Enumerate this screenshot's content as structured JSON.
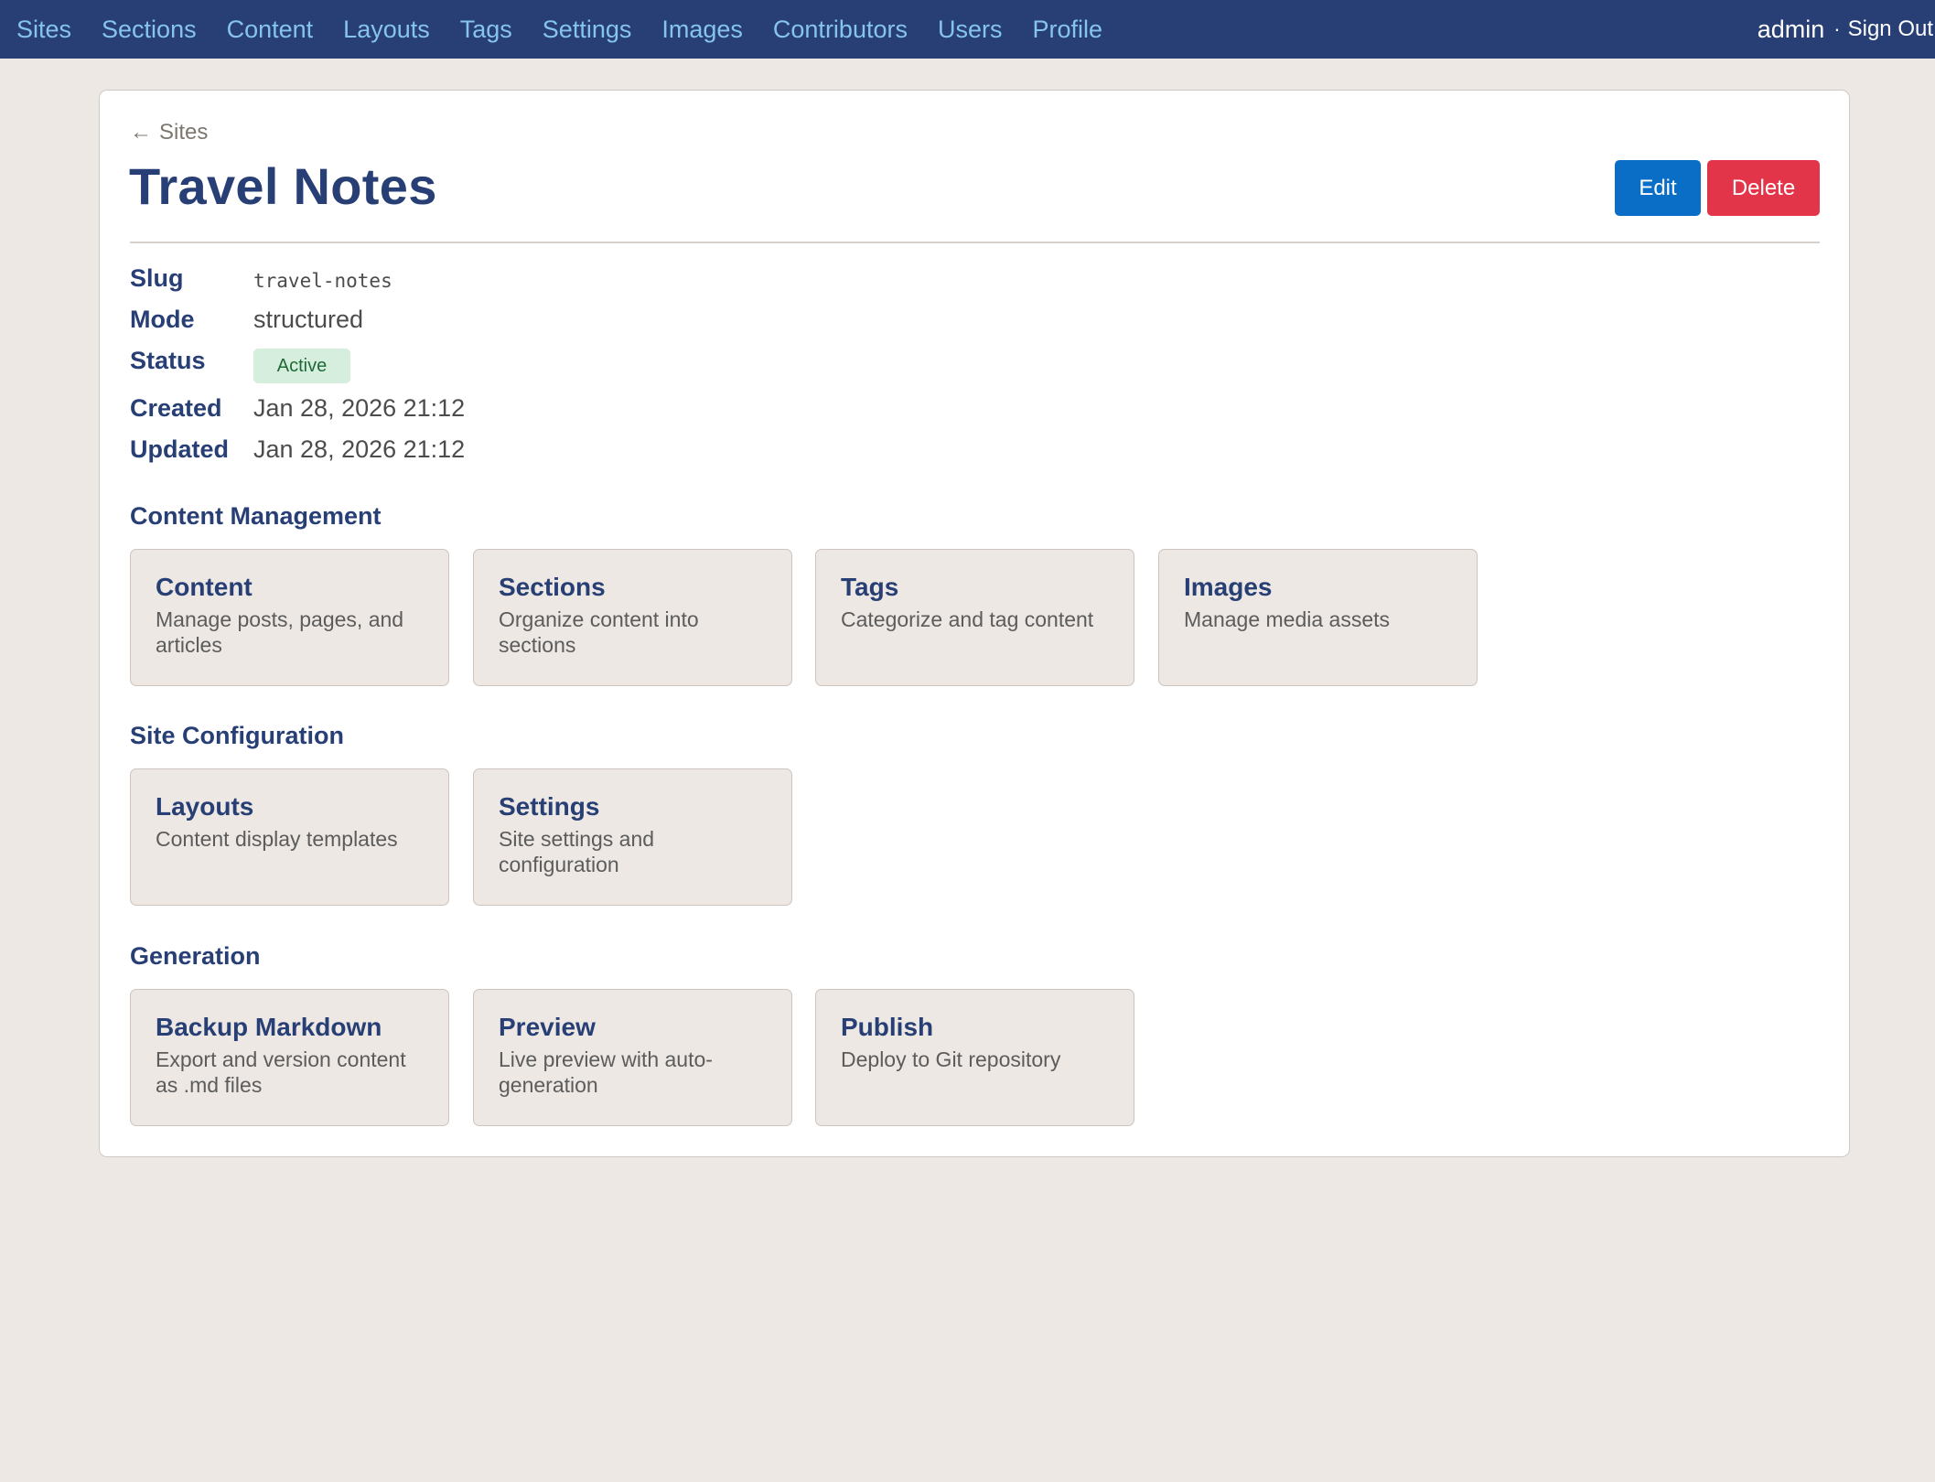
{
  "topnav": {
    "items": [
      "Sites",
      "Sections",
      "Content",
      "Layouts",
      "Tags",
      "Settings",
      "Images",
      "Contributors",
      "Users",
      "Profile"
    ],
    "user": "admin",
    "separator": "·",
    "signout": "Sign Out"
  },
  "page": {
    "back_label": "Sites",
    "title": "Travel Notes",
    "edit_label": "Edit",
    "delete_label": "Delete"
  },
  "details": {
    "slug_label": "Slug",
    "slug_value": "travel-notes",
    "mode_label": "Mode",
    "mode_value": "structured",
    "status_label": "Status",
    "status_value": "Active",
    "created_label": "Created",
    "created_value": "Jan 28, 2026 21:12",
    "updated_label": "Updated",
    "updated_value": "Jan 28, 2026 21:12"
  },
  "content_management": {
    "heading": "Content Management",
    "tiles": [
      {
        "title": "Content",
        "desc": "Manage posts, pages, and articles"
      },
      {
        "title": "Sections",
        "desc": "Organize content into sections"
      },
      {
        "title": "Tags",
        "desc": "Categorize and tag content"
      },
      {
        "title": "Images",
        "desc": "Manage media assets"
      }
    ]
  },
  "site_configuration": {
    "heading": "Site Configuration",
    "tiles": [
      {
        "title": "Layouts",
        "desc": "Content display templates"
      },
      {
        "title": "Settings",
        "desc": "Site settings and configuration"
      }
    ]
  },
  "generation": {
    "heading": "Generation",
    "tiles": [
      {
        "title": "Backup Markdown",
        "desc": "Export and version content as .md files"
      },
      {
        "title": "Preview",
        "desc": "Live preview with auto-generation"
      },
      {
        "title": "Publish",
        "desc": "Deploy to Git repository"
      }
    ]
  },
  "colors": {
    "navbar": "#273f75",
    "nav_link": "#86c4ee",
    "edit_button": "#0a6ec6",
    "delete_button": "#e3354a",
    "active_badge_bg": "#d6eedd",
    "active_badge_text": "#1d6a37"
  }
}
